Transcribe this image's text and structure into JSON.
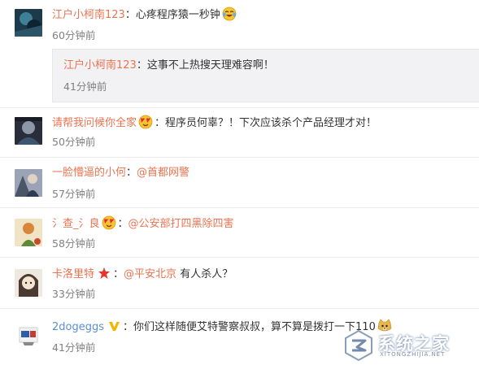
{
  "comments": [
    {
      "username": "江户小柯南123",
      "text": "心疼程序猿一秒钟",
      "emoji": "crying-laugh",
      "time": "60分钟前",
      "reply": {
        "username": "江户小柯南123",
        "text": "这事不上热搜天理难容啊！",
        "time": "41分钟前"
      }
    },
    {
      "username": "请帮我问候你全家",
      "emoji": "heart-eyes",
      "text": "程序员何辜？！下次应该杀个产品经理才对！",
      "time": "50分钟前"
    },
    {
      "username": "一脸懵逼的小何",
      "mention": "@首都网警",
      "time": "57分钟前"
    },
    {
      "username": "氵查_氵良",
      "emoji": "heart-eyes",
      "mention": "@公安部打四黑除四害",
      "time": "58分钟前"
    },
    {
      "username": "卡洛里特",
      "badge": "star-icon",
      "mention": "@平安北京",
      "text": "有人杀人？",
      "time": "33分钟前"
    },
    {
      "username": "2dogeggs",
      "badge": "verified-v-icon",
      "text": "你们这样随便艾特警察叔叔，算不算是拨打一下110",
      "emoji": "doge",
      "time": "41分钟前"
    }
  ],
  "watermark": {
    "text": "系统之家",
    "subtext": "XITONGZHIJIA.NET"
  },
  "colors": {
    "username": "#eb7350",
    "username_blue": "#5b8ed1",
    "time": "#808080",
    "reply_bg": "#f2f2f5"
  }
}
